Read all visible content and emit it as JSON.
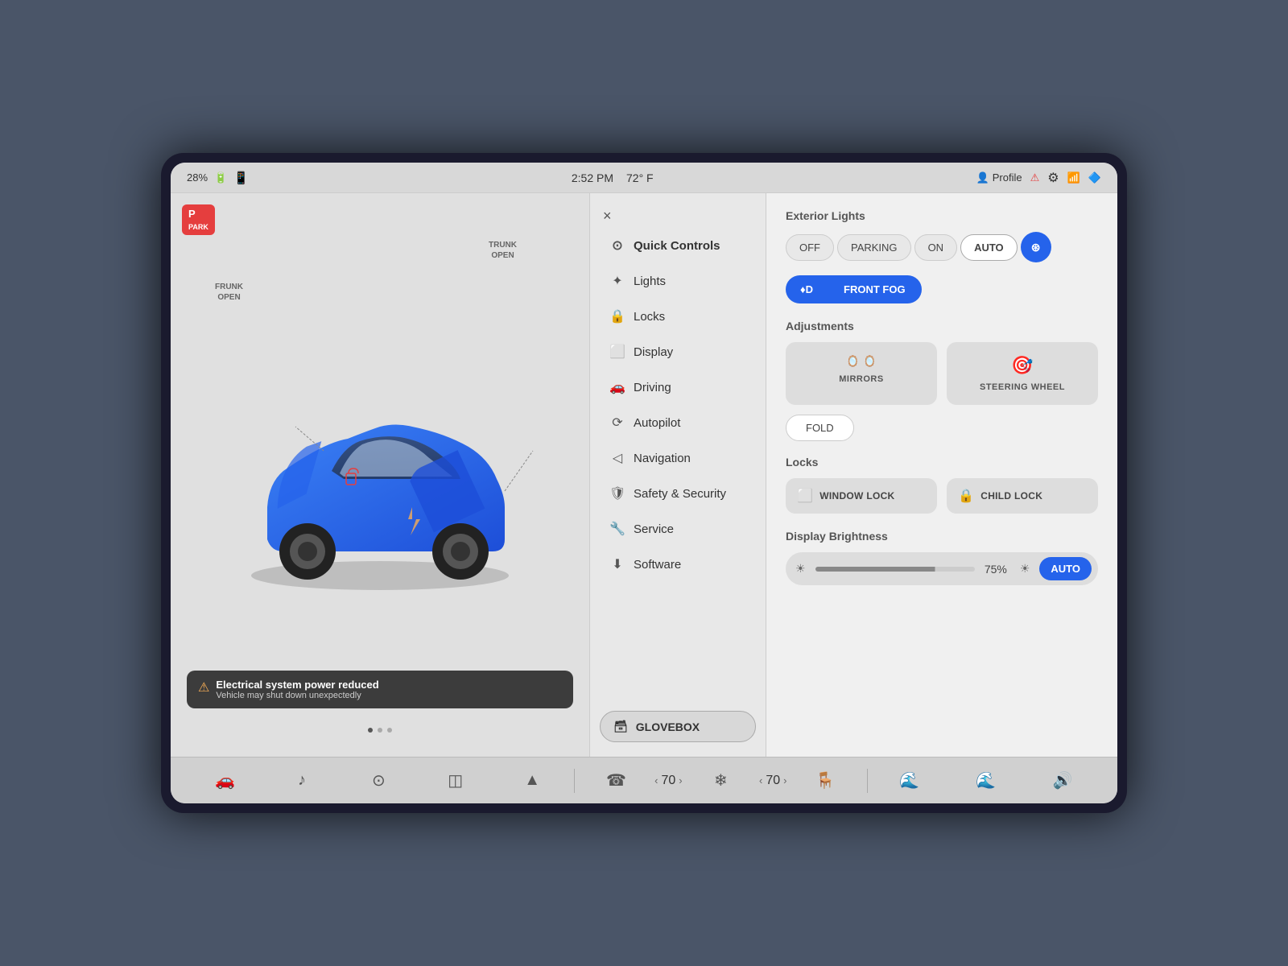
{
  "statusBar": {
    "battery": "28%",
    "time": "2:52 PM",
    "temp": "72° F",
    "profile": "Profile",
    "signal": "LTE"
  },
  "carPanel": {
    "parkLabel": "P",
    "trunkLabel": "TRUNK\nOPEN",
    "frunkLabel": "FRUNK\nOPEN",
    "warning": {
      "title": "Electrical system power reduced",
      "subtitle": "Vehicle may shut down unexpectedly"
    }
  },
  "menu": {
    "closeLabel": "×",
    "items": [
      {
        "id": "quick-controls",
        "label": "Quick Controls",
        "icon": "⊙"
      },
      {
        "id": "lights",
        "label": "Lights",
        "icon": "✦"
      },
      {
        "id": "locks",
        "label": "Locks",
        "icon": "🔒"
      },
      {
        "id": "display",
        "label": "Display",
        "icon": "⬜"
      },
      {
        "id": "driving",
        "label": "Driving",
        "icon": "🚗"
      },
      {
        "id": "autopilot",
        "label": "Autopilot",
        "icon": "⟳"
      },
      {
        "id": "navigation",
        "label": "Navigation",
        "icon": "⟩"
      },
      {
        "id": "safety",
        "label": "Safety & Security",
        "icon": "🛡"
      },
      {
        "id": "service",
        "label": "Service",
        "icon": "🔧"
      },
      {
        "id": "software",
        "label": "Software",
        "icon": "⬇"
      }
    ],
    "gloveboxLabel": "GLOVEBOX"
  },
  "controls": {
    "exteriorLightsTitle": "Exterior Lights",
    "lightButtons": [
      "OFF",
      "PARKING",
      "ON",
      "AUTO"
    ],
    "activeLightBtn": "AUTO",
    "fogButtons": [
      "♦D",
      "FRONT FOG"
    ],
    "adjustmentsTitle": "Adjustments",
    "mirrors": "MIRRORS",
    "steeringWheel": "STEERING WHEEL",
    "foldLabel": "FOLD",
    "locksTitle": "Locks",
    "windowLock": "WINDOW LOCK",
    "childLock": "CHILD LOCK",
    "brightnessTitle": "Display Brightness",
    "brightnessValue": "75%",
    "brightnessAuto": "AUTO"
  },
  "bottomBar": {
    "leftTemp": "70",
    "rightTemp": "70",
    "icons": [
      "🚗",
      "♪",
      "⊙",
      "◫",
      "▲",
      "☎",
      "❄",
      "⚡",
      "☎",
      "🌊",
      "🌊",
      "🔊"
    ]
  }
}
